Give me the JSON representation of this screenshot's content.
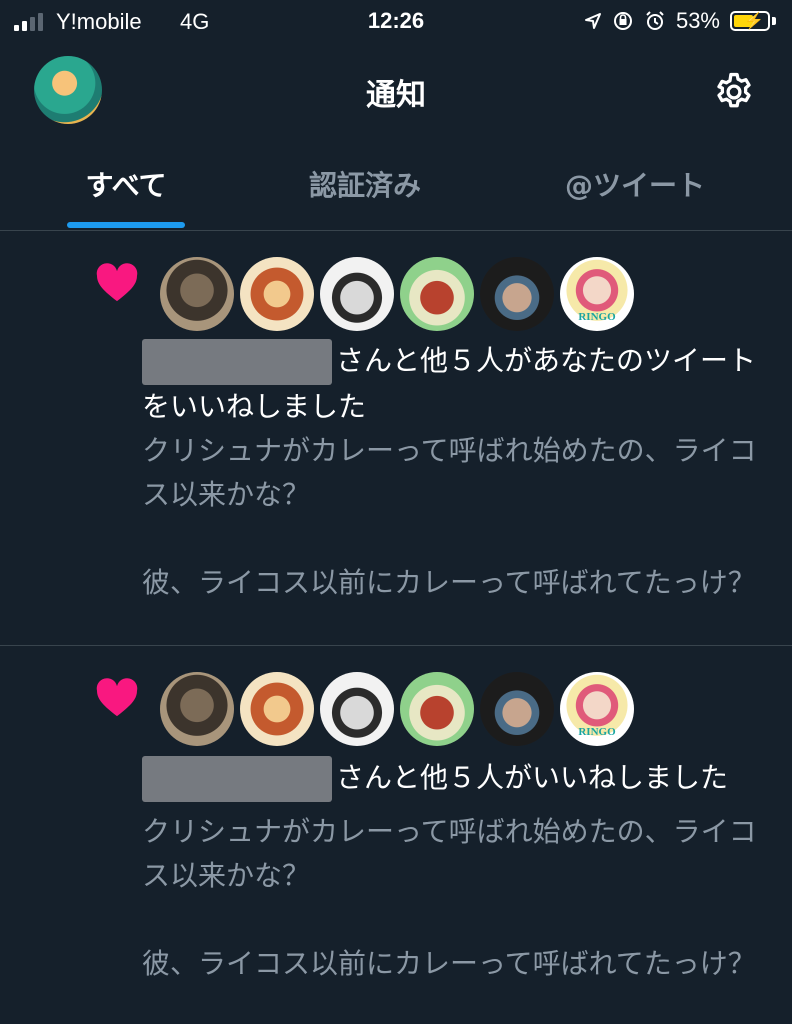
{
  "status": {
    "carrier": "Y!mobile",
    "network": "4G",
    "time": "12:26",
    "battery": "53%"
  },
  "header": {
    "title": "通知"
  },
  "tabs": [
    {
      "label": "すべて",
      "active": true
    },
    {
      "label": "認証済み",
      "active": false
    },
    {
      "label": "@ツイート",
      "active": false
    }
  ],
  "notifications": [
    {
      "action_text": "さんと他５人があなたのツイートをいいねしました",
      "tweet_p1": "クリシュナがカレーって呼ばれ始めたの、ライコス以来かな？",
      "tweet_p2": "彼、ライコス以前にカレーって呼ばれてたっけ？",
      "avatar6_tag": "RINGO"
    },
    {
      "action_text": "さんと他５人がいいねしました",
      "tweet_p1": "クリシュナがカレーって呼ばれ始めたの、ライコス以来かな？",
      "tweet_p2": "彼、ライコス以前にカレーって呼ばれてたっけ？",
      "avatar6_tag": "RINGO"
    }
  ],
  "colors": {
    "background": "#15202b",
    "accent": "#1d9bf0",
    "like": "#f91880",
    "secondary_text": "#8b98a5"
  }
}
